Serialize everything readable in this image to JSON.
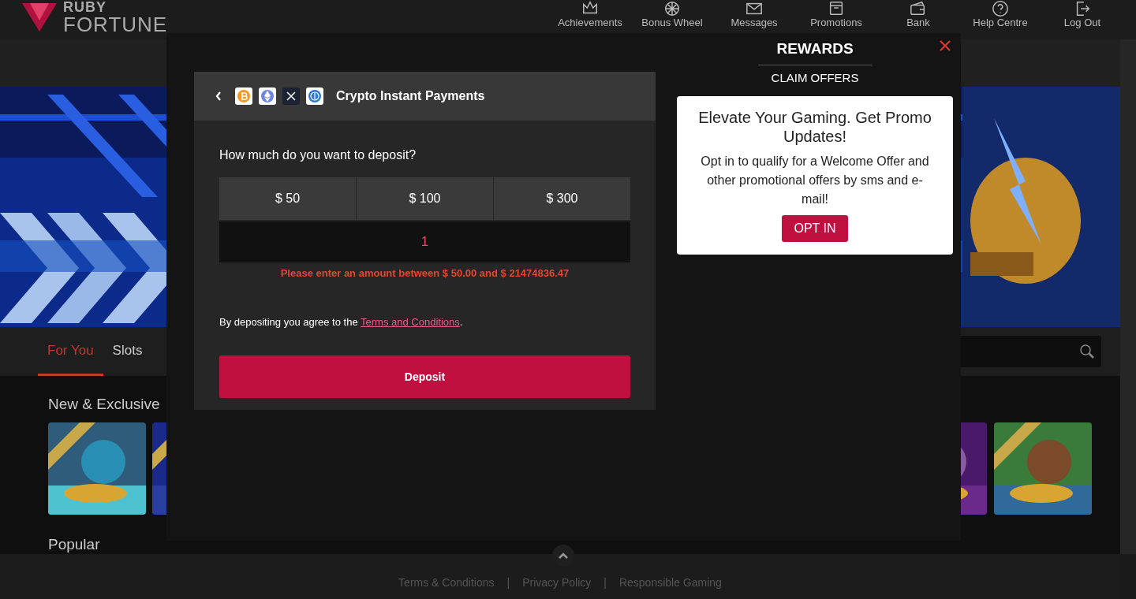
{
  "header": {
    "logo_top": "RUBY",
    "logo_bottom": "FORTUNE",
    "nav": [
      {
        "label": "Achievements"
      },
      {
        "label": "Bonus Wheel"
      },
      {
        "label": "Messages"
      },
      {
        "label": "Promotions"
      },
      {
        "label": "Bank"
      },
      {
        "label": "Help Centre"
      },
      {
        "label": "Log Out"
      }
    ]
  },
  "tabs": [
    {
      "label": "For You",
      "selected": true
    },
    {
      "label": "Slots",
      "selected": false
    }
  ],
  "sections": [
    {
      "title": "New & Exclusive"
    },
    {
      "title": "Popular"
    }
  ],
  "footer": {
    "links": [
      "Terms & Conditions",
      "Privacy Policy",
      "Responsible Gaming"
    ],
    "separator": "|"
  },
  "deposit": {
    "title": "Crypto Instant Payments",
    "question": "How much do you want to deposit?",
    "amounts": [
      {
        "label": "$ 50",
        "selected": false
      },
      {
        "label": "$ 100",
        "selected": false
      },
      {
        "label": "$ 300",
        "selected": false
      }
    ],
    "amount_value": "1",
    "error": "Please enter an amount between $ 50.00 and $ 21474836.47",
    "agree_text": "By depositing you agree to the ",
    "terms_link": "Terms and Conditions",
    "agree_end": ".",
    "button": "Deposit"
  },
  "rewards": {
    "title": "REWARDS",
    "subtitle": "CLAIM OFFERS",
    "promo": {
      "heading": "Elevate Your Gaming. Get Promo Updates!",
      "body": "Opt in to qualify for a Welcome Offer and other promotional offers by sms and e-mail!",
      "button": "OPT IN"
    }
  }
}
